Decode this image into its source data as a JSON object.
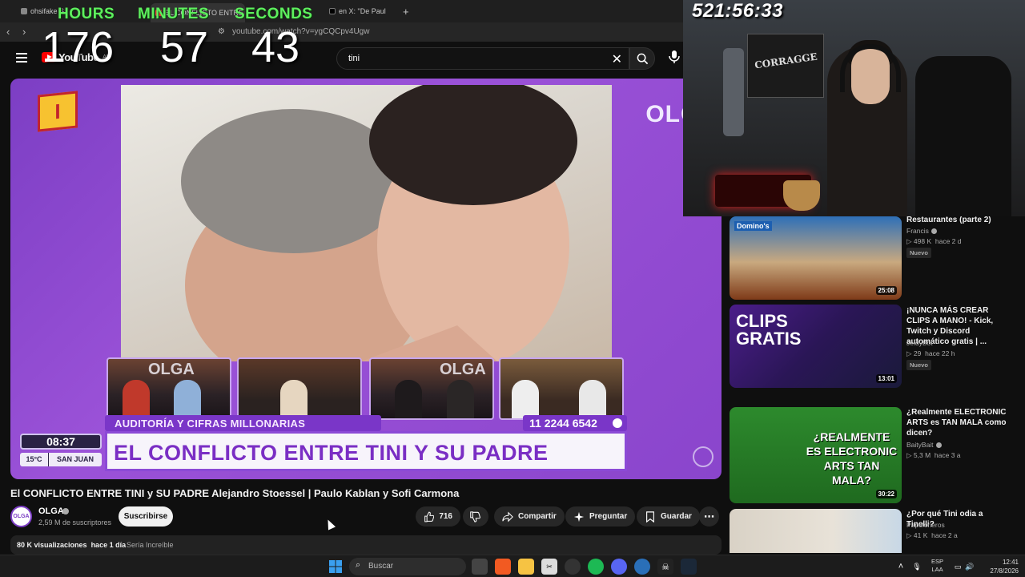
{
  "browser": {
    "tabs": [
      {
        "title": "ohsifake S"
      },
      {
        "title": "EL CONFLICTO ENTRE TINI"
      },
      {
        "title": "en X: \"De Paul"
      }
    ],
    "url": "youtube.com/watch?v=ygCQCpv4Ugw",
    "new_tab_label": "+"
  },
  "timer": {
    "hours_label": "HOURS",
    "minutes_label": "MINUTES",
    "seconds_label": "SECONDS",
    "hours": "176",
    "minutes": "57",
    "seconds": "43"
  },
  "stream": {
    "elapsed": "521:56:33",
    "poster_text": "CORRAGGE"
  },
  "youtube": {
    "logo_text": "YouTube",
    "logo_country": "AR",
    "search_query": "tini"
  },
  "player": {
    "brand_right": "OLGA",
    "cube_letter": "I",
    "cam_brand": "OLGA",
    "subtitle": "AUDITORÍA Y CIFRAS MILLONARIAS",
    "phone": "11 2244 6542",
    "headline": "EL CONFLICTO ENTRE TINI Y SU PADRE",
    "clock": "08:37",
    "temperature": "15°C",
    "city": "SAN JUAN"
  },
  "video": {
    "title": "El CONFLICTO ENTRE TINI y SU PADRE Alejandro Stoessel | Paulo Kablan y Sofi Carmona",
    "channel": "OLGA",
    "avatar_text": "OLGA",
    "subscribers": "2,59 M de suscriptores",
    "subscribe_label": "Suscribirse",
    "likes": "716",
    "share_label": "Compartir",
    "ask_label": "Preguntar",
    "save_label": "Guardar",
    "views": "80 K visualizaciones",
    "ago": "hace 1 día",
    "tag": "Sería Increíble"
  },
  "recommendations": [
    {
      "title": "Restaurantes (parte 2)",
      "channel": "Francis",
      "views": "498 K",
      "ago": "hace 2 d",
      "badge": "Nuevo",
      "duration": "25:08",
      "thumb_text": "Domino's"
    },
    {
      "title": "¡NUNCA MÁS CREAR CLIPS A MANO! - Kick, Twitch y Discord automático gratis | ...",
      "channel": "JeidyBot",
      "views": "29",
      "ago": "hace 22 h",
      "badge": "Nuevo",
      "duration": "13:01",
      "thumb_text": "CLIPS GRATIS"
    },
    {
      "title": "¿Realmente ELECTRONIC ARTS es TAN MALA como dicen?",
      "channel": "BaityBait",
      "views": "5,3 M",
      "ago": "hace 3 a",
      "duration": "30:22",
      "thumb_text": "¿REALMENTE ES ELECTRONIC ARTS TAN MALA?"
    },
    {
      "title": "¿Por qué Tini odia a Tinelli?",
      "channel": "Papeloneros",
      "views": "41 K",
      "ago": "hace 2 a"
    }
  ],
  "taskbar": {
    "search_label": "Buscar",
    "lang_line1": "ESP",
    "lang_line2": "LAA",
    "time": "12:41",
    "date": "27/8/2026"
  }
}
